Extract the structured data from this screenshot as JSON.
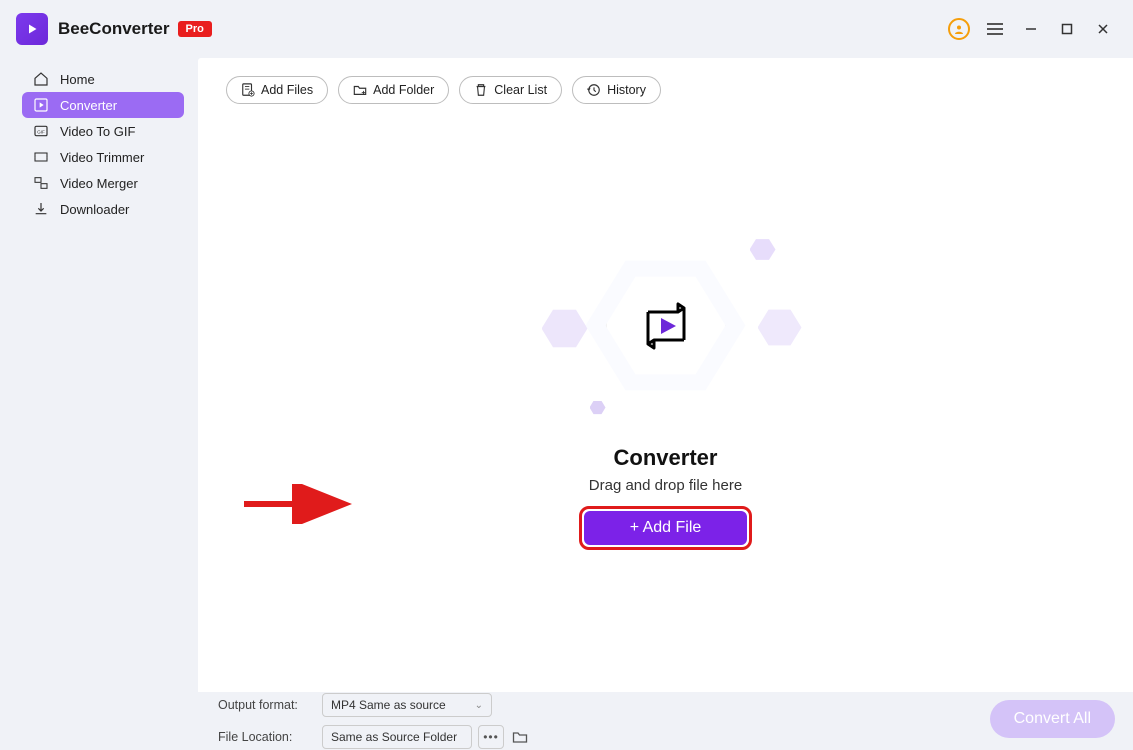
{
  "header": {
    "app_name": "BeeConverter",
    "pro_badge": "Pro"
  },
  "sidebar": {
    "items": [
      {
        "id": "home",
        "label": "Home"
      },
      {
        "id": "converter",
        "label": "Converter"
      },
      {
        "id": "video-to-gif",
        "label": "Video To GIF"
      },
      {
        "id": "video-trimmer",
        "label": "Video Trimmer"
      },
      {
        "id": "video-merger",
        "label": "Video Merger"
      },
      {
        "id": "downloader",
        "label": "Downloader"
      }
    ],
    "active": "converter"
  },
  "toolbar": {
    "add_files": "Add Files",
    "add_folder": "Add Folder",
    "clear_list": "Clear List",
    "history": "History"
  },
  "center": {
    "title": "Converter",
    "subtitle": "Drag and drop file here",
    "add_file_label": "+ Add File"
  },
  "bottom": {
    "output_format_label": "Output format:",
    "output_format_value": "MP4 Same as source",
    "file_location_label": "File Location:",
    "file_location_value": "Same as Source Folder",
    "convert_all": "Convert All"
  }
}
